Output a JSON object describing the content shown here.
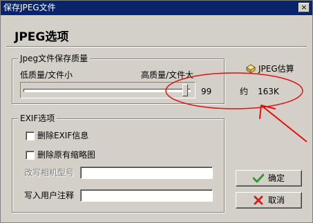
{
  "window": {
    "title": "保存JPEG文件",
    "close_glyph": "×"
  },
  "heading": "JPEG选项",
  "quality_group": {
    "legend": "Jpeg文件保存质量",
    "low_label": "低质量/文件小",
    "high_label": "高质量/文件大",
    "slider_value": 99,
    "slider_min": 0,
    "slider_max": 100,
    "value_text": "99"
  },
  "estimate": {
    "button_label": "JPEG估算",
    "approx_label": "约",
    "size_text": "163K"
  },
  "exif_group": {
    "legend": "EXIF选项",
    "delete_exif_label": "删除EXIF信息",
    "delete_exif_checked": false,
    "delete_thumb_label": "删除原有缩略图",
    "delete_thumb_checked": false,
    "camera_model_label": "改写相机型号",
    "camera_model_value": "",
    "user_comment_label": "写入用户注释",
    "user_comment_value": ""
  },
  "buttons": {
    "ok_label": "确定",
    "cancel_label": "取消"
  },
  "annotation": {
    "color": "#e01010"
  },
  "colors": {
    "face": "#d4d0c8",
    "titlebar": "#0a246a",
    "ok_check": "#2e9a2e",
    "cancel_x": "#cc2222"
  }
}
